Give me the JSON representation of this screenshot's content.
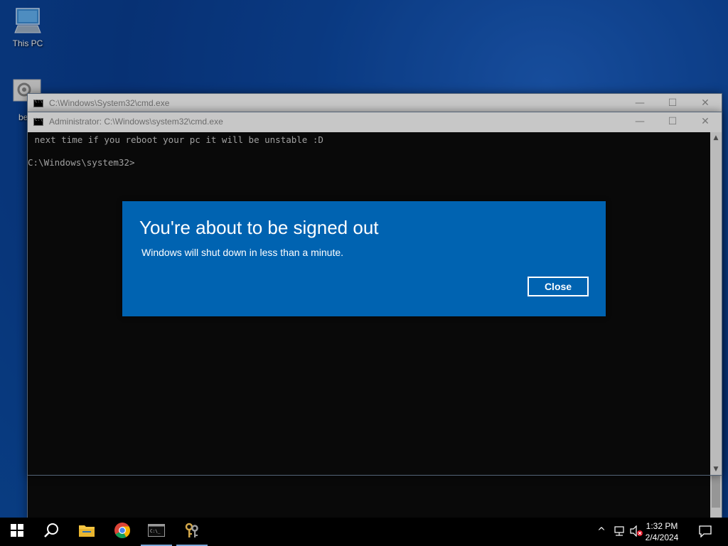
{
  "desktop": {
    "icons": [
      {
        "label": "This PC",
        "icon": "computer-icon"
      },
      {
        "label": "be",
        "icon": "settings-file-icon"
      }
    ]
  },
  "windows": {
    "back": {
      "title": "C:\\Windows\\System32\\cmd.exe",
      "buttons": {
        "minimize": "—",
        "maximize": "☐",
        "close": "✕"
      }
    },
    "front": {
      "title": "Administrator: C:\\Windows\\system32\\cmd.exe",
      "buttons": {
        "minimize": "—",
        "maximize": "☐",
        "close": "✕"
      },
      "console_lines": [
        " next time if you reboot your pc it will be unstable :D",
        "C:\\Windows\\system32>"
      ]
    }
  },
  "dialog": {
    "title": "You're about to be signed out",
    "message": "Windows will shut down in less than a minute.",
    "close_label": "Close",
    "color": "#0063b1"
  },
  "taskbar": {
    "items": [
      "start-icon",
      "search-icon",
      "file-explorer-icon",
      "chrome-icon",
      "cmd-icon",
      "keys-icon"
    ],
    "tray": {
      "chevron": "^",
      "time": "1:32 PM",
      "date": "2/4/2024"
    }
  }
}
